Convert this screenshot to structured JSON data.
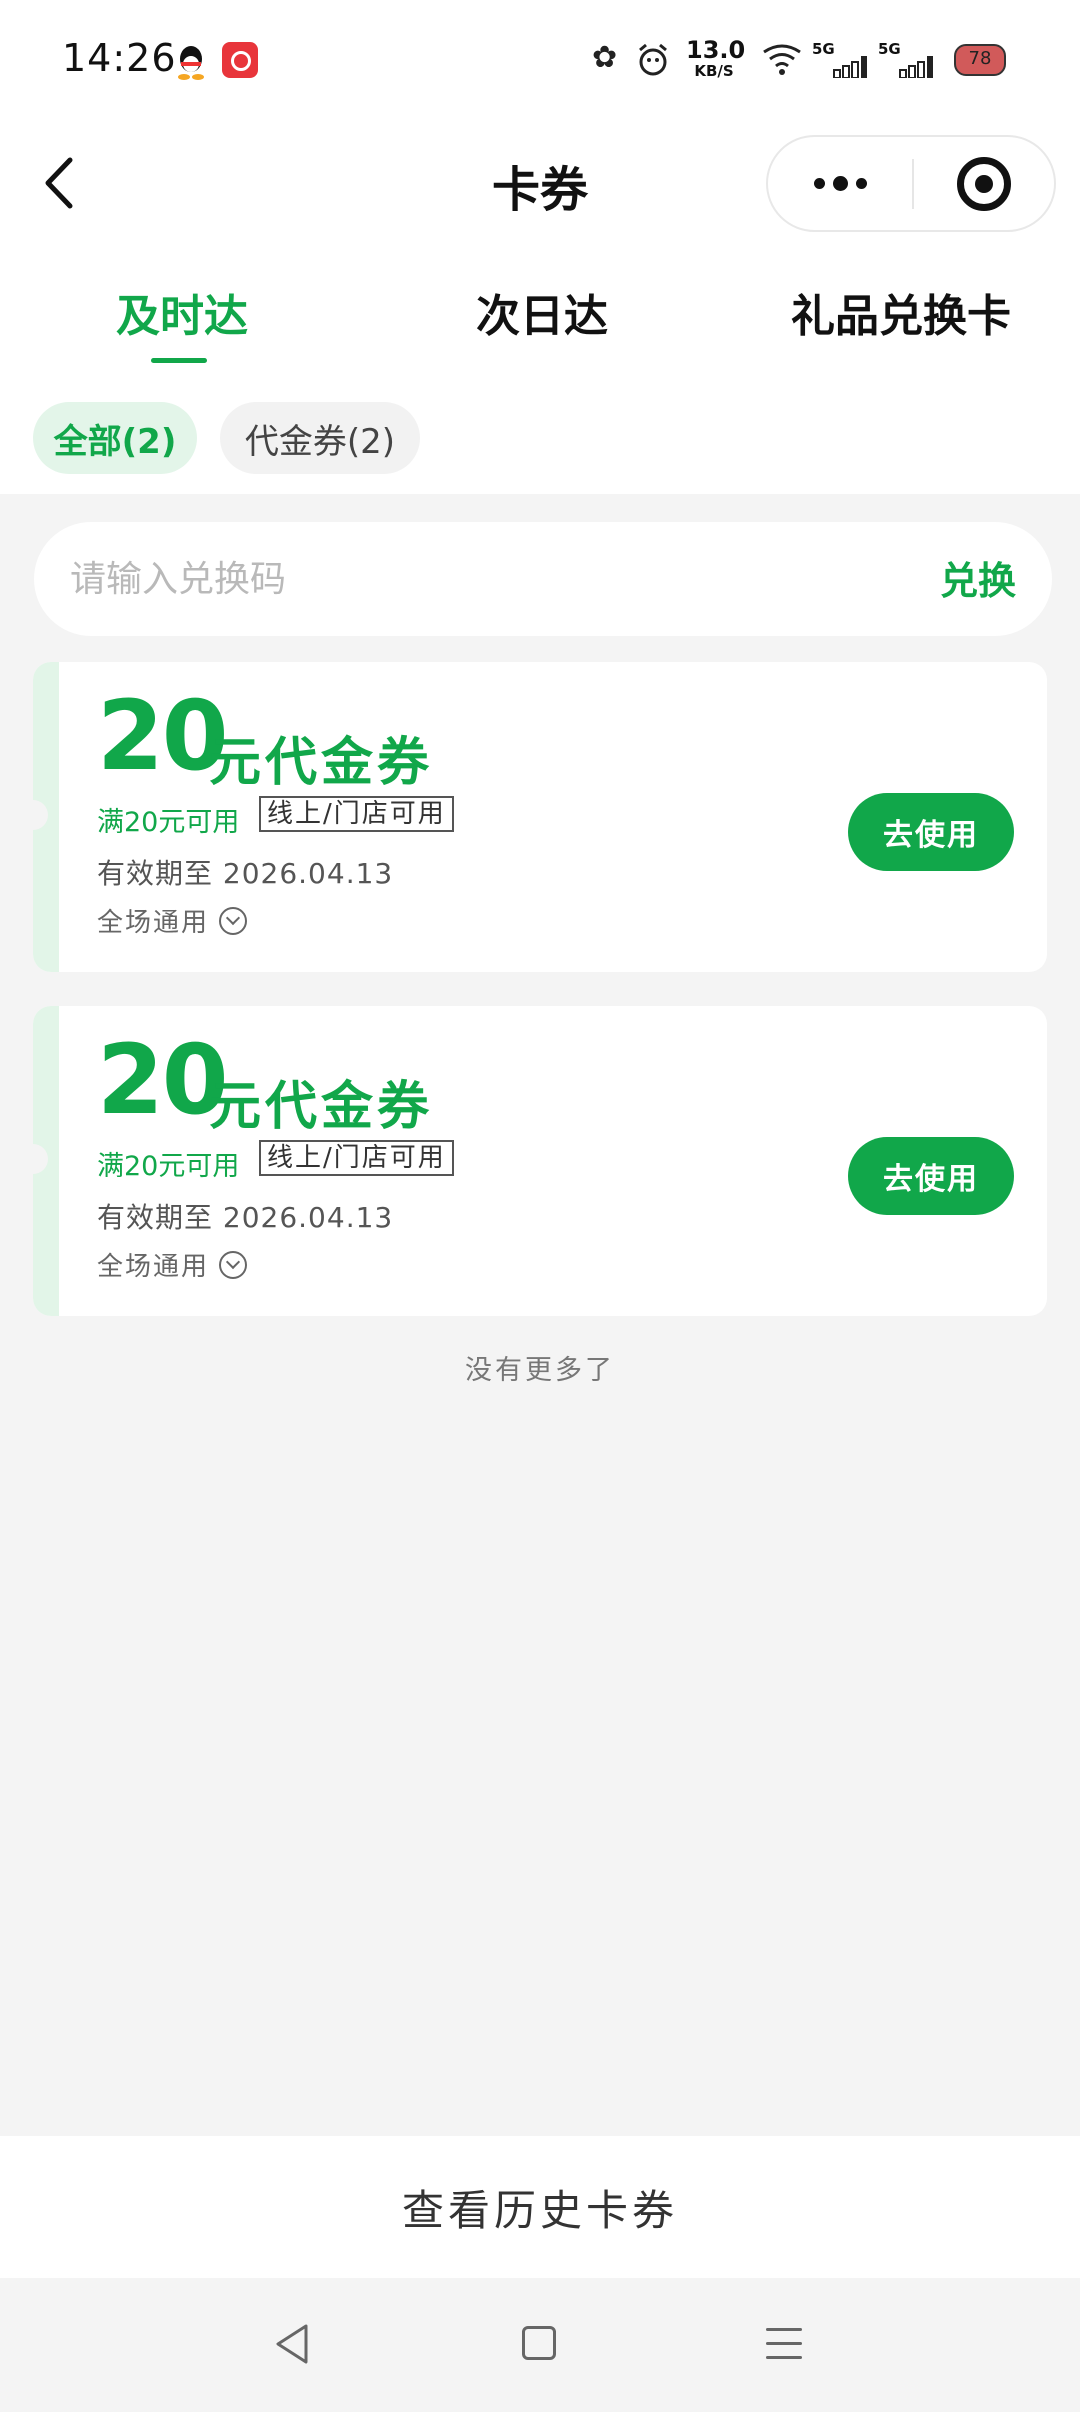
{
  "status_bar": {
    "time": "14:26",
    "speed_value": "13.0",
    "speed_unit": "KB/S",
    "signal_1": "5G",
    "signal_2": "5G",
    "battery": "78"
  },
  "header": {
    "title": "卡券"
  },
  "tabs": [
    {
      "label": "及时达",
      "active": true
    },
    {
      "label": "次日达",
      "active": false
    },
    {
      "label": "礼品兑换卡",
      "active": false
    }
  ],
  "filters": [
    {
      "label": "全部(2)",
      "active": true
    },
    {
      "label": "代金券(2)",
      "active": false
    }
  ],
  "redeem": {
    "placeholder": "请输入兑换码",
    "button_label": "兑换"
  },
  "coupons": [
    {
      "amount": "20",
      "name": "元代金券",
      "condition": "满20元可用",
      "tag": "线上/门店可用",
      "expiry": "有效期至 2026.04.13",
      "scope": "全场通用",
      "button_label": "去使用"
    },
    {
      "amount": "20",
      "name": "元代金券",
      "condition": "满20元可用",
      "tag": "线上/门店可用",
      "expiry": "有效期至 2026.04.13",
      "scope": "全场通用",
      "button_label": "去使用"
    }
  ],
  "list_end_text": "没有更多了",
  "footer": {
    "history_label": "查看历史卡券"
  },
  "colors": {
    "accent": "#11a74a",
    "accent_light": "#e3f5e9",
    "page_background": "#f4f4f4"
  }
}
